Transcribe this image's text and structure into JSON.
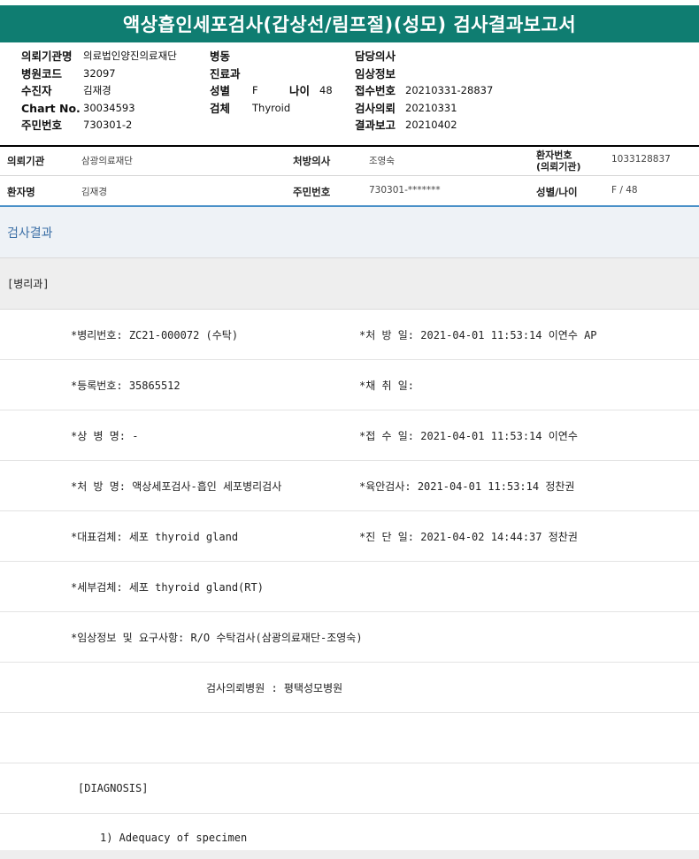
{
  "title": "액상흡인세포검사(갑상선/림프절)(성모) 검사결과보고서",
  "header": {
    "col1": [
      {
        "label": "의뢰기관명",
        "value": "의료법인양진의료재단"
      },
      {
        "label": "병원코드",
        "value": "32097"
      },
      {
        "label": "수진자",
        "value": "김재경"
      },
      {
        "label": "Chart No.",
        "value": "30034593"
      },
      {
        "label": "주민번호",
        "value": "730301-2"
      }
    ],
    "col2": [
      {
        "label": "병동",
        "value": ""
      },
      {
        "label": "진료과",
        "value": ""
      },
      {
        "label": "성별",
        "value": "F"
      },
      {
        "label": "검체",
        "value": "Thyroid"
      }
    ],
    "age": {
      "label": "나이",
      "value": "48"
    },
    "col3": [
      {
        "label": "담당의사",
        "value": ""
      },
      {
        "label": "임상정보",
        "value": ""
      },
      {
        "label": "접수번호",
        "value": "20210331-28837"
      },
      {
        "label": "검사의뢰",
        "value": "20210331"
      },
      {
        "label": "결과보고",
        "value": "20210402"
      }
    ]
  },
  "info": {
    "row1": {
      "inst_label": "의뢰기관",
      "inst_value": "삼광의료재단",
      "doctor_label": "처방의사",
      "doctor_value": "조영숙",
      "pid_label_line1": "환자번호",
      "pid_label_line2": "(의뢰기관)",
      "pid_value": "1033128837"
    },
    "row2": {
      "name_label": "환자명",
      "name_value": "김재경",
      "ssn_label": "주민번호",
      "ssn_value": "730301-*******",
      "sexage_label": "성별/나이",
      "sexage_value": "F / 48"
    }
  },
  "section_title": "검사결과",
  "department": "[병리과]",
  "results": [
    {
      "left": "*병리번호: ZC21-000072 (수탁)",
      "right": "*처 방 일: 2021-04-01 11:53:14  이연수 AP"
    },
    {
      "left": "*등록번호: 35865512",
      "right": "*채 취 일:"
    },
    {
      "left": "*상 병 명: -",
      "right": "*접 수 일: 2021-04-01 11:53:14  이연수"
    },
    {
      "left": "*처 방 명: 액상세포검사-흡인 세포병리검사",
      "right": "*육안검사: 2021-04-01 11:53:14  정찬권"
    },
    {
      "left": "*대표검체: 세포 thyroid gland",
      "right": "*진 단 일: 2021-04-02 14:44:37  정찬권"
    },
    {
      "left": "*세부검체: 세포 thyroid gland(RT)",
      "right": ""
    },
    {
      "left": "*임상정보 및 요구사항: R/O 수탁검사(삼광의료재단-조영숙)",
      "right": ""
    }
  ],
  "referral_hospital": "검사의뢰병원  : 평택성모병원",
  "diagnosis_label": "[DIAGNOSIS]",
  "adequacy": "1) Adequacy of specimen"
}
